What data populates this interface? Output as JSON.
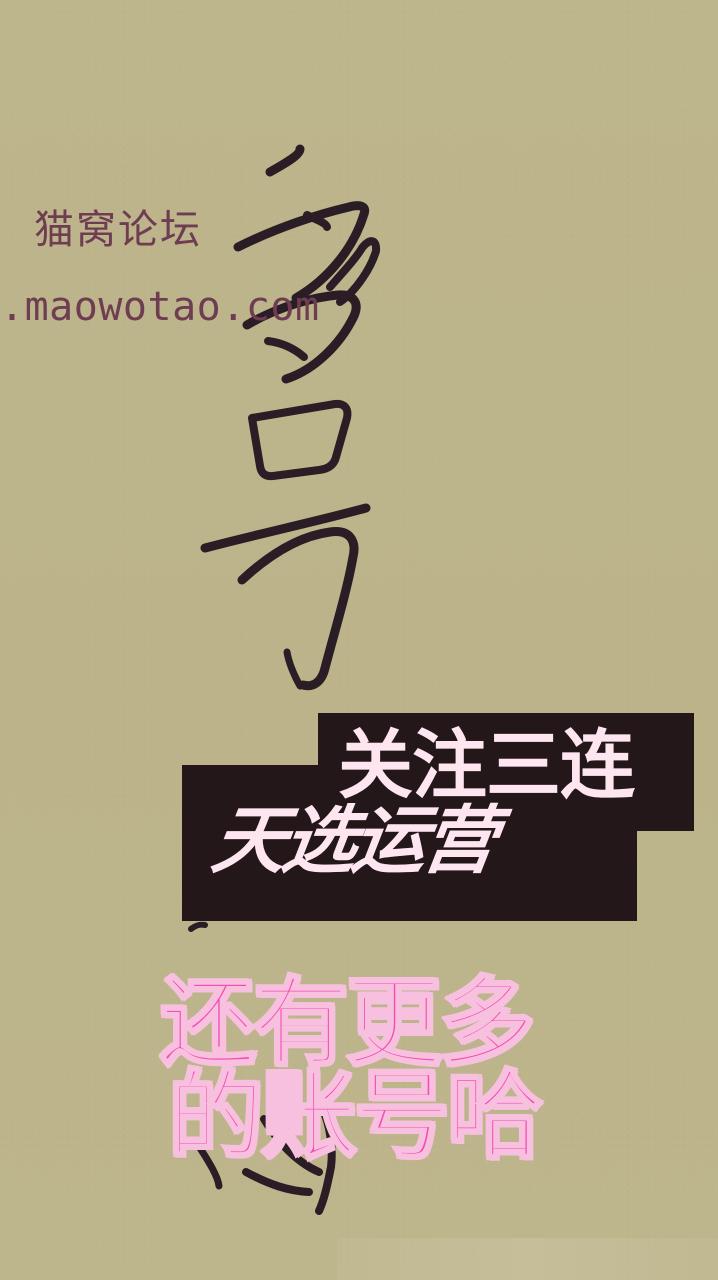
{
  "watermark": {
    "site_name": "猫窝论坛",
    "url_text": ".maowotao.com"
  },
  "overlay": {
    "follow_text": "关注三连",
    "tianxuan_text": "天选运营",
    "more_line_1": "还有更多",
    "more_line_2": "的账号哈"
  },
  "palette": {
    "background": "#bdb58b",
    "dark_box": "#24171a",
    "light_text": "#fde6f0",
    "pink_text": "#f64bb3",
    "watermark": "#6f3d51"
  }
}
